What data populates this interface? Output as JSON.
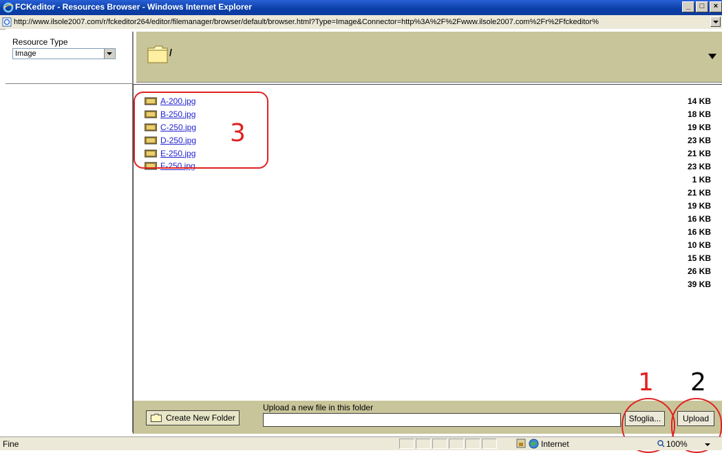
{
  "window": {
    "title": "FCKeditor - Resources Browser - Windows Internet Explorer",
    "url": "http://www.ilsole2007.com/r/fckeditor264/editor/filemanager/browser/default/browser.html?Type=Image&Connector=http%3A%2F%2Fwww.ilsole2007.com%2Fr%2Ffckeditor%",
    "minimize": "_",
    "restore": "□",
    "close": "×"
  },
  "resource_type": {
    "label": "Resource Type",
    "selected": "Image"
  },
  "path": "/",
  "files": [
    {
      "name": "A-200.jpg",
      "size": "14 KB"
    },
    {
      "name": "B-250.jpg",
      "size": "18 KB"
    },
    {
      "name": "C-250.jpg",
      "size": "19 KB"
    },
    {
      "name": "D-250.jpg",
      "size": "23 KB"
    },
    {
      "name": "E-250.jpg",
      "size": "21 KB"
    },
    {
      "name": "F-250.jpg",
      "size": "23 KB"
    }
  ],
  "extra_sizes": [
    "1 KB",
    "21 KB",
    "19 KB",
    "16 KB",
    "16 KB",
    "10 KB",
    "15 KB",
    "26 KB",
    "39 KB"
  ],
  "bottom": {
    "create_folder_label": "Create New Folder",
    "upload_label": "Upload a new file in this folder",
    "browse_label": "Sfoglia...",
    "upload_button_label": "Upload"
  },
  "annotations": {
    "one": "1",
    "two": "2",
    "three": "3"
  },
  "status": {
    "text": "Fine",
    "zone": "Internet",
    "zoom": "100%"
  },
  "colors": {
    "accent_annotation": "#e02020",
    "panel_bg": "#c8c59a",
    "link": "#1f1fd0"
  }
}
